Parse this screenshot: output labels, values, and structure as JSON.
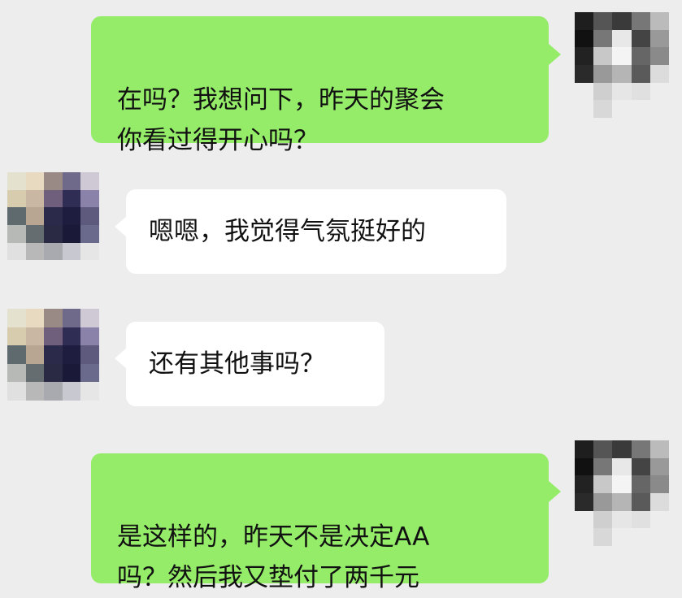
{
  "messages": [
    {
      "side": "right",
      "text": "在吗？我想问下，昨天的聚会\n你看过得开心吗？"
    },
    {
      "side": "left",
      "text": "嗯嗯，我觉得气氛挺好的"
    },
    {
      "side": "left",
      "text": "还有其他事吗？"
    },
    {
      "side": "right",
      "text": "是这样的，昨天不是决定AA\n吗？然后我又垫付了两千元"
    }
  ],
  "colors": {
    "background": "#ededed",
    "my_bubble": "#95ec69",
    "their_bubble": "#ffffff"
  },
  "avatars": {
    "me": "pixelated-avatar",
    "contact": "pixelated-avatar"
  }
}
